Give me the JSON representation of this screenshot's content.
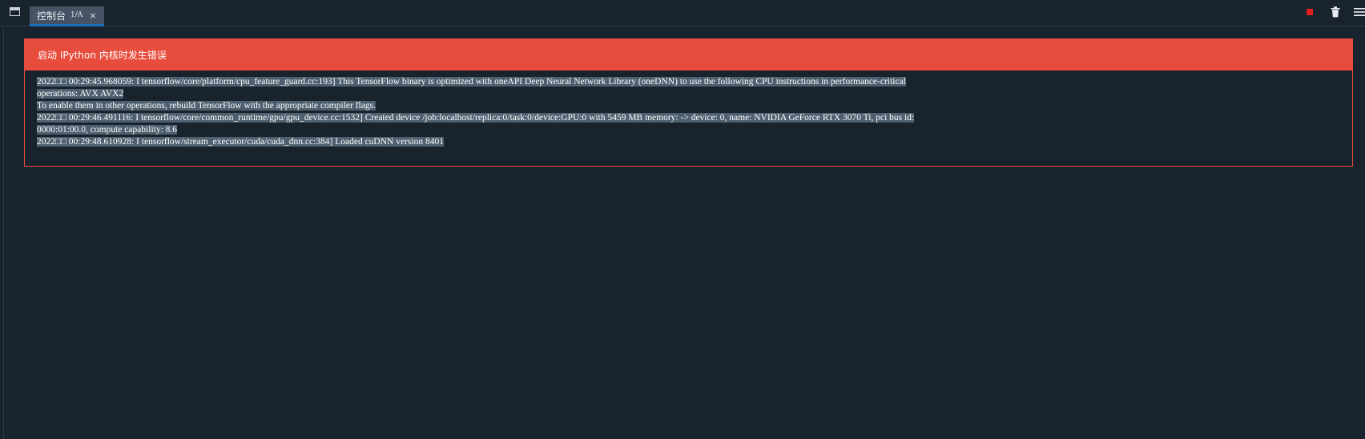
{
  "tabs": [
    {
      "label": "控制台",
      "count": "1/A",
      "close": "×"
    }
  ],
  "error": {
    "title": "启动 IPython 内核时发生错误",
    "lines": [
      {
        "selected": "2022□□ 00:29:45.968059: I tensorflow/core/platform/cpu_feature_guard.cc:193] This TensorFlow binary is optimized with oneAPI Deep Neural Network Library (oneDNN) to use the following CPU instructions in performance-critical",
        "rest": ""
      },
      {
        "selected": "operations: AVX AVX2",
        "rest": ""
      },
      {
        "selected": "To enable them in other operations, rebuild TensorFlow with the appropriate compiler flags.",
        "rest": ""
      },
      {
        "selected": "2022□□ 00:29:46.491116: I tensorflow/core/common_runtime/gpu/gpu_device.cc:1532] Created device /job:localhost/replica:0/task:0/device:GPU:0 with 5459 MB memory: -> device: 0, name: NVIDIA GeForce RTX 3070 Ti, pci bus id:",
        "rest": ""
      },
      {
        "selected": "0000:01:00.0, compute capability: 8.6",
        "rest": ""
      },
      {
        "selected": "2022□□ 00:29:48.610928: I tensorflow/stream_executor/cuda/cuda_dnn.cc:384] Loaded cuDNN version 8401",
        "rest": ""
      }
    ]
  },
  "icons": {
    "pane": "window-pane-icon",
    "stop": "stop-icon",
    "trash": "trash-icon",
    "menu": "hamburger-menu-icon"
  },
  "colors": {
    "background": "#19232d",
    "tab_active": "#455364",
    "tab_accent": "#1a72bb",
    "error": "#e74c3c",
    "selection": "#4e5f6f",
    "stop": "#e0201e"
  }
}
